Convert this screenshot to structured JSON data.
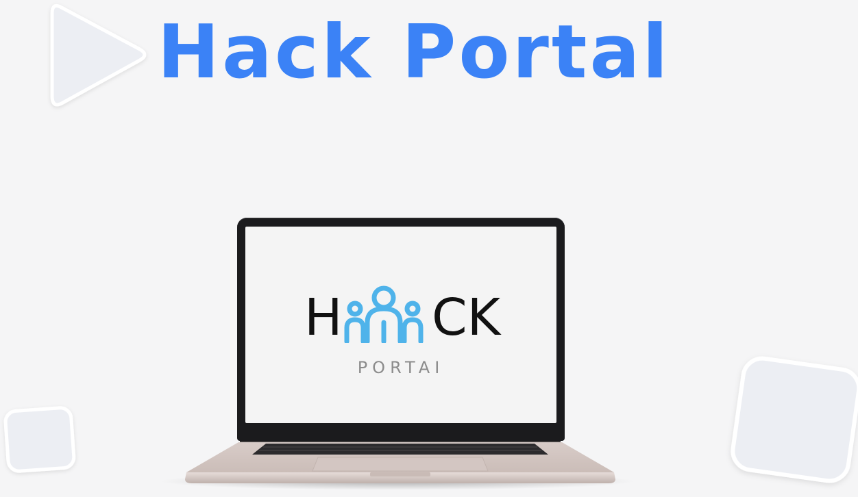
{
  "header": {
    "title": "Hack Portal"
  },
  "screen": {
    "logo": {
      "letter_h": "H",
      "letters_ck": "CK",
      "subtitle": "PORTAI",
      "icon_color": "#4fb3ea"
    }
  },
  "colors": {
    "background": "#f5f5f6",
    "title": "#3b82f6",
    "deco_shape": "#eceef3"
  },
  "icons": [
    "play-triangle-decoration-icon",
    "rounded-square-decoration-icon",
    "people-icon"
  ]
}
